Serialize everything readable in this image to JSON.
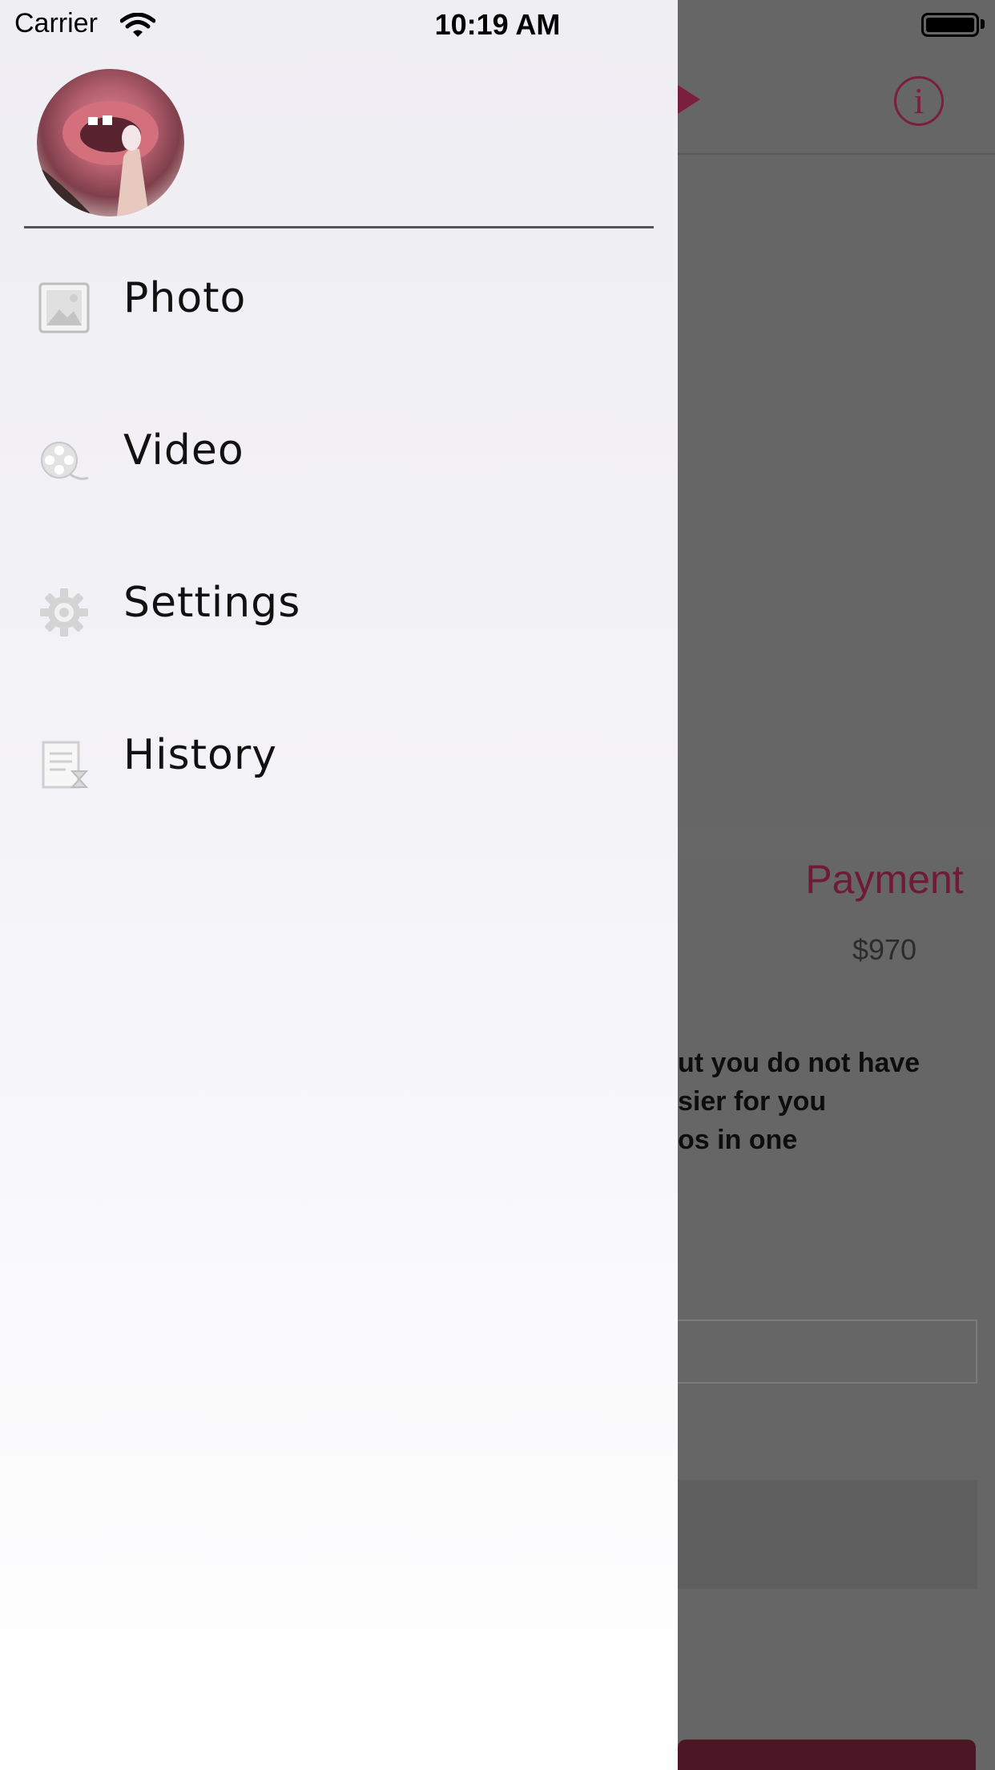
{
  "status_bar": {
    "carrier": "Carrier",
    "time": "10:19 AM"
  },
  "drawer": {
    "menu": [
      {
        "label": "Photo",
        "icon": "photo-icon"
      },
      {
        "label": "Video",
        "icon": "video-reel-icon"
      },
      {
        "label": "Settings",
        "icon": "gear-icon"
      },
      {
        "label": "History",
        "icon": "history-icon"
      }
    ]
  },
  "background": {
    "payment_title": "Payment",
    "payment_amount": "$970",
    "description_lines": [
      "ut you do not have",
      "sier for you",
      "os in one"
    ],
    "accent_color": "#7a1f3d"
  }
}
